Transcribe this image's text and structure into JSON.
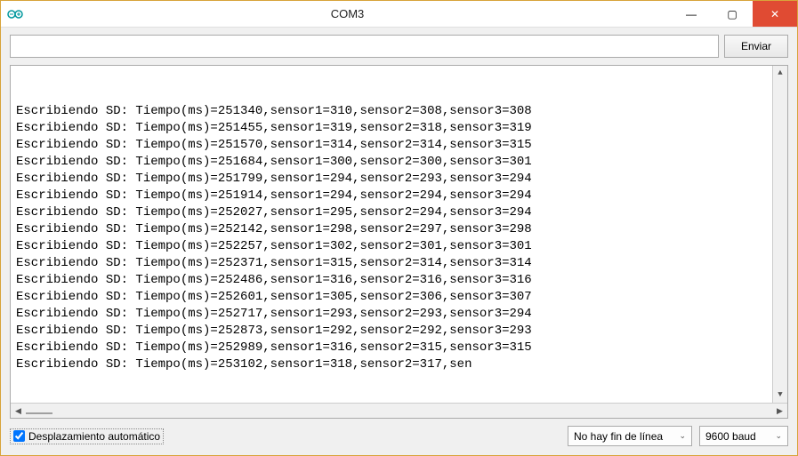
{
  "window": {
    "title": "COM3",
    "minimize_glyph": "—",
    "maximize_glyph": "▢",
    "close_glyph": "✕"
  },
  "toolbar": {
    "input_value": "",
    "send_label": "Enviar"
  },
  "console": {
    "lines": [
      "Escribiendo SD: Tiempo(ms)=251340,sensor1=310,sensor2=308,sensor3=308",
      "Escribiendo SD: Tiempo(ms)=251455,sensor1=319,sensor2=318,sensor3=319",
      "Escribiendo SD: Tiempo(ms)=251570,sensor1=314,sensor2=314,sensor3=315",
      "Escribiendo SD: Tiempo(ms)=251684,sensor1=300,sensor2=300,sensor3=301",
      "Escribiendo SD: Tiempo(ms)=251799,sensor1=294,sensor2=293,sensor3=294",
      "Escribiendo SD: Tiempo(ms)=251914,sensor1=294,sensor2=294,sensor3=294",
      "Escribiendo SD: Tiempo(ms)=252027,sensor1=295,sensor2=294,sensor3=294",
      "Escribiendo SD: Tiempo(ms)=252142,sensor1=298,sensor2=297,sensor3=298",
      "Escribiendo SD: Tiempo(ms)=252257,sensor1=302,sensor2=301,sensor3=301",
      "Escribiendo SD: Tiempo(ms)=252371,sensor1=315,sensor2=314,sensor3=314",
      "Escribiendo SD: Tiempo(ms)=252486,sensor1=316,sensor2=316,sensor3=316",
      "Escribiendo SD: Tiempo(ms)=252601,sensor1=305,sensor2=306,sensor3=307",
      "Escribiendo SD: Tiempo(ms)=252717,sensor1=293,sensor2=293,sensor3=294",
      "Escribiendo SD: Tiempo(ms)=252873,sensor1=292,sensor2=292,sensor3=293",
      "Escribiendo SD: Tiempo(ms)=252989,sensor1=316,sensor2=315,sensor3=315",
      "Escribiendo SD: Tiempo(ms)=253102,sensor1=318,sensor2=317,sen"
    ]
  },
  "bottombar": {
    "autoscroll_label": "Desplazamiento automático",
    "autoscroll_checked": true,
    "line_ending_selected": "No hay fin de línea",
    "baud_selected": "9600 baud"
  },
  "glyphs": {
    "caret_down": "⌄",
    "tri_left": "◀",
    "tri_right": "▶",
    "tri_up": "▲",
    "tri_down": "▼"
  }
}
